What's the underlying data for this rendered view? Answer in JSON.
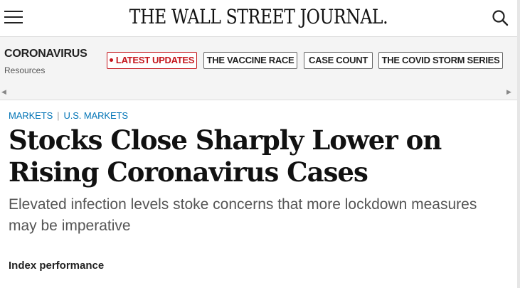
{
  "header": {
    "masthead": "THE WALL STREET JOURNAL.",
    "menu_icon": "hamburger-menu-icon",
    "search_icon": "search-icon"
  },
  "subnav": {
    "section": "CORONAVIRUS",
    "subtitle": "Resources",
    "links": [
      {
        "label": "LATEST UPDATES",
        "highlight": true
      },
      {
        "label": "THE VACCINE RACE",
        "highlight": false
      },
      {
        "label": "CASE COUNT",
        "highlight": false
      },
      {
        "label": "THE COVID STORM SERIES",
        "highlight": false
      }
    ],
    "scroll_left_icon": "triangle-left-icon",
    "scroll_right_icon": "triangle-right-icon"
  },
  "article": {
    "breadcrumb": [
      "MARKETS",
      "U.S. MARKETS"
    ],
    "headline": "Stocks Close Sharply Lower on Rising Coronavirus Cases",
    "dek": "Elevated infection levels stoke concerns that more lockdown measures may be imperative",
    "section_heading": "Index performance"
  },
  "colors": {
    "accent_red": "#c4161c",
    "link_blue": "#0274b6",
    "subnav_bg": "#f4f4f4"
  }
}
